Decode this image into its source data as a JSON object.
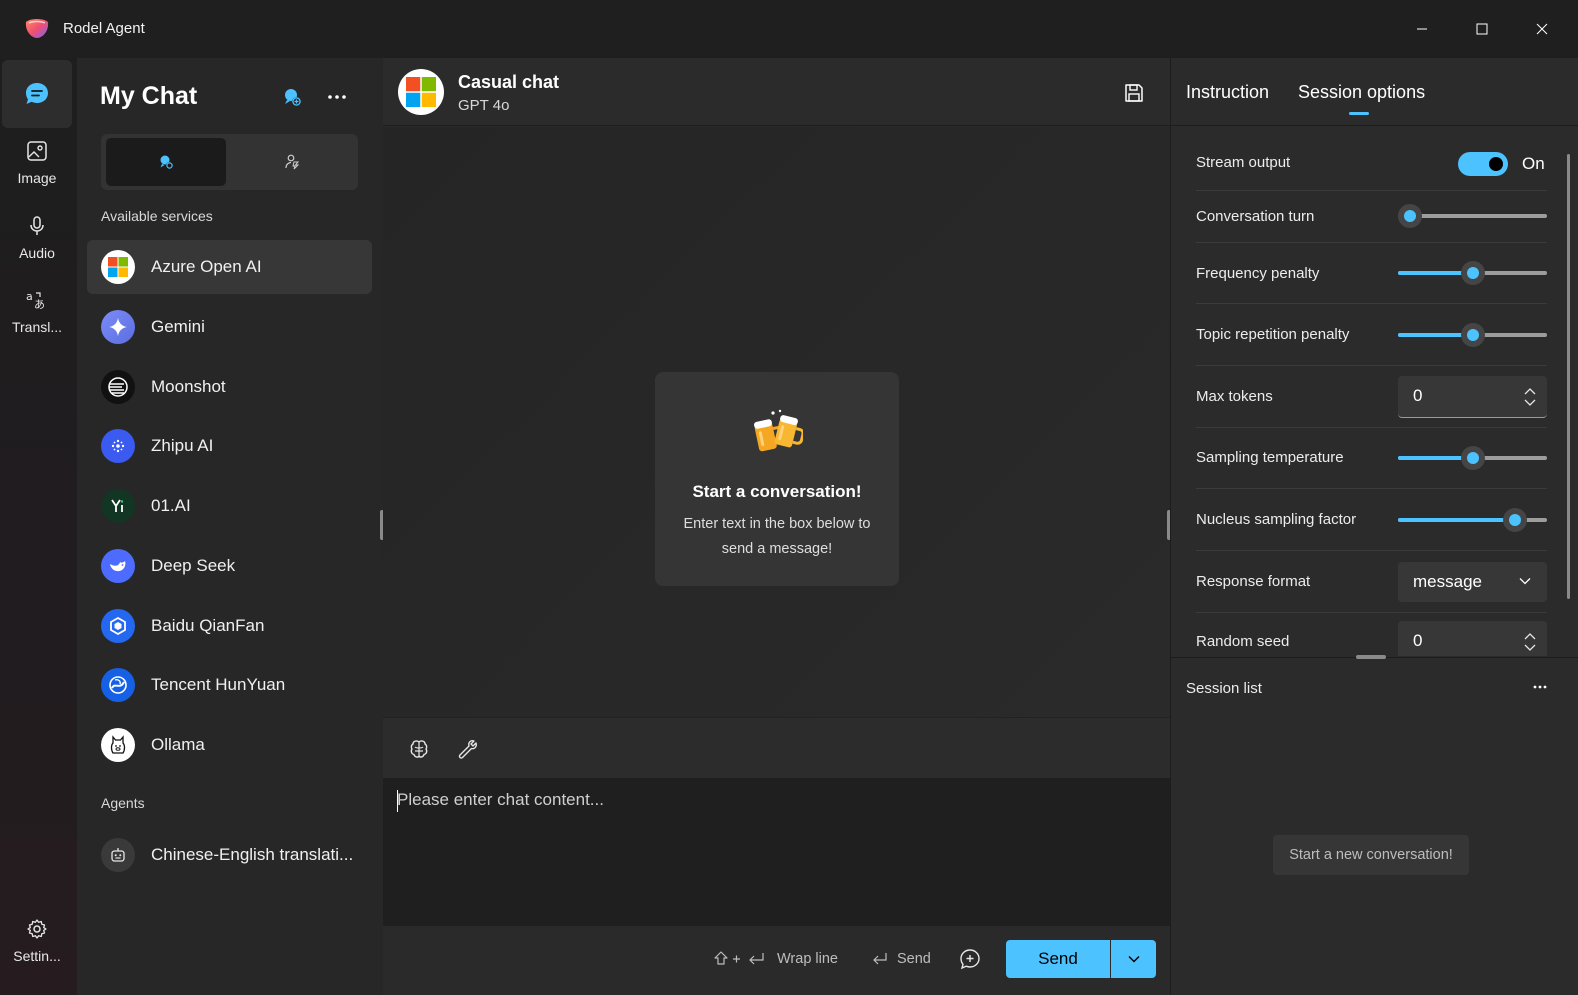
{
  "window": {
    "title": "Rodel Agent"
  },
  "rail": {
    "items": [
      {
        "label": "",
        "icon": "chat-icon"
      },
      {
        "label": "Image",
        "icon": "image-icon"
      },
      {
        "label": "Audio",
        "icon": "microphone-icon"
      },
      {
        "label": "Transl...",
        "icon": "translate-icon"
      }
    ],
    "settings_label": "Settin..."
  },
  "sidebar": {
    "title": "My Chat",
    "available_label": "Available services",
    "services": [
      {
        "label": "Azure Open AI",
        "icon": "microsoft-logo-icon"
      },
      {
        "label": "Gemini",
        "icon": "gemini-logo-icon"
      },
      {
        "label": "Moonshot",
        "icon": "moonshot-logo-icon"
      },
      {
        "label": "Zhipu AI",
        "icon": "zhipu-logo-icon"
      },
      {
        "label": "01.AI",
        "icon": "01ai-logo-icon"
      },
      {
        "label": "Deep Seek",
        "icon": "deepseek-logo-icon"
      },
      {
        "label": "Baidu QianFan",
        "icon": "baidu-logo-icon"
      },
      {
        "label": "Tencent HunYuan",
        "icon": "tencent-logo-icon"
      },
      {
        "label": "Ollama",
        "icon": "ollama-logo-icon"
      }
    ],
    "agents_label": "Agents",
    "agents": [
      {
        "label": "Chinese-English translati...",
        "icon": "bot-icon"
      }
    ]
  },
  "chat": {
    "title": "Casual chat",
    "model": "GPT 4o",
    "welcome_title": "Start a conversation!",
    "welcome_desc": "Enter text in the box below to send a message!",
    "input_placeholder": "Please enter chat content...",
    "hint_wrap": "Wrap line",
    "hint_send": "Send",
    "send_label": "Send"
  },
  "options": {
    "tabs": [
      "Instruction",
      "Session options"
    ],
    "active_tab": "Session options",
    "stream_output": {
      "label": "Stream output",
      "state": "On",
      "on": true
    },
    "conversation_turn": {
      "label": "Conversation turn",
      "level": 0.0
    },
    "frequency_penalty": {
      "label": "Frequency penalty",
      "level": 0.5
    },
    "topic_repetition_penalty": {
      "label": "Topic repetition penalty",
      "level": 0.5
    },
    "max_tokens": {
      "label": "Max tokens",
      "value": "0"
    },
    "sampling_temperature": {
      "label": "Sampling temperature",
      "level": 0.5
    },
    "nucleus_sampling_factor": {
      "label": "Nucleus sampling factor",
      "level": 0.84
    },
    "response_format": {
      "label": "Response format",
      "value": "message"
    },
    "random_seed": {
      "label": "Random seed",
      "value": "0"
    }
  },
  "session": {
    "title": "Session list",
    "new_conversation": "Start a new conversation!"
  },
  "colors": {
    "accent": "#4cc2ff",
    "background": "#202020"
  }
}
